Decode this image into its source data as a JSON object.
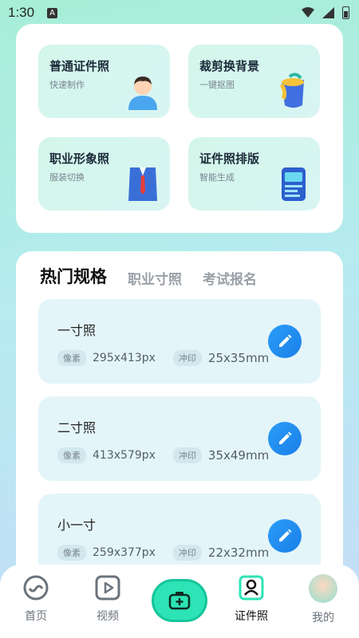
{
  "status_bar": {
    "time": "1:30",
    "notif_letter": "A"
  },
  "tools": [
    {
      "title": "普通证件照",
      "subtitle": "快速制作",
      "icon": "person-avatar-icon"
    },
    {
      "title": "裁剪换背景",
      "subtitle": "一键抠图",
      "icon": "paint-bucket-icon"
    },
    {
      "title": "职业形象照",
      "subtitle": "服装切换",
      "icon": "suit-icon"
    },
    {
      "title": "证件照排版",
      "subtitle": "智能生成",
      "icon": "id-card-icon"
    }
  ],
  "tabs": [
    {
      "label": "热门规格",
      "active": true
    },
    {
      "label": "职业寸照",
      "active": false
    },
    {
      "label": "考试报名",
      "active": false
    }
  ],
  "specs": [
    {
      "name": "一寸照",
      "pixel_tag": "像素",
      "pixels": "295x413px",
      "print_tag": "冲印",
      "print": "25x35mm"
    },
    {
      "name": "二寸照",
      "pixel_tag": "像素",
      "pixels": "413x579px",
      "print_tag": "冲印",
      "print": "35x49mm"
    },
    {
      "name": "小一寸",
      "pixel_tag": "像素",
      "pixels": "259x377px",
      "print_tag": "冲印",
      "print": "22x32mm"
    }
  ],
  "nav": [
    {
      "label": "首页",
      "icon": "home-icon"
    },
    {
      "label": "视频",
      "icon": "video-icon"
    },
    {
      "label": "",
      "icon": "camera-icon"
    },
    {
      "label": "证件照",
      "icon": "id-photo-icon"
    },
    {
      "label": "我的",
      "icon": "avatar-icon"
    }
  ],
  "colors": {
    "accent": "#2ce4b5",
    "edit_button": "#1f8ef0",
    "tool_bg": "#d3f6ea",
    "spec_bg": "#e4f5f9"
  }
}
